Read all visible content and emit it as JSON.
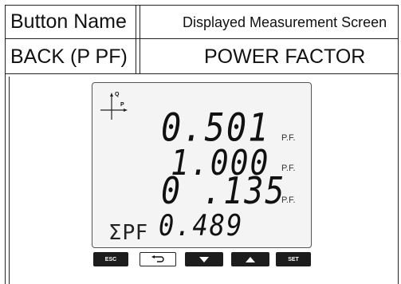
{
  "table": {
    "header": {
      "col1": "Button Name",
      "col2": "Displayed Measurement Screen"
    },
    "row": {
      "button_name": "BACK (P PF)",
      "screen_name": "POWER FACTOR"
    }
  },
  "display": {
    "quadrant_labels": {
      "q": "Q",
      "p": "P"
    },
    "lines": [
      {
        "value": "0.501",
        "unit": "P.F."
      },
      {
        "value": "1.000",
        "unit": "P.F."
      },
      {
        "value": "0 .135",
        "unit": "P.F."
      }
    ],
    "sum": {
      "label": "ΣPF",
      "value": "0.489"
    }
  },
  "buttons": [
    {
      "label": "ESC",
      "icon": "esc-button"
    },
    {
      "label": "",
      "icon": "back-arrow-icon"
    },
    {
      "label": "",
      "icon": "triangle-down-icon"
    },
    {
      "label": "",
      "icon": "triangle-up-icon"
    },
    {
      "label": "SET",
      "icon": "set-button"
    }
  ]
}
